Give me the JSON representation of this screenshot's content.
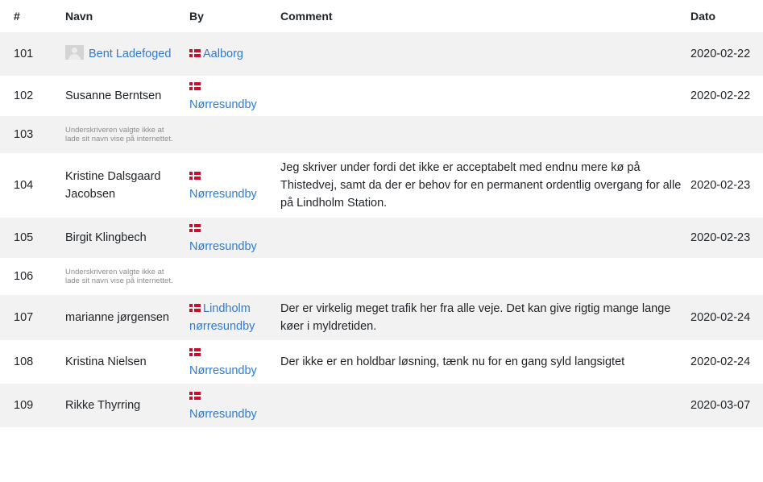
{
  "headers": {
    "num": "#",
    "name": "Navn",
    "city": "By",
    "comment": "Comment",
    "date": "Dato"
  },
  "hidden_note": "Underskriveren valgte ikke at lade sit navn vise på internettet.",
  "colors": {
    "link": "#2e7bd6",
    "stripe": "#f2f2f2",
    "flag_red": "#c8102e"
  },
  "rows": [
    {
      "num": "101",
      "name": "Bent Ladefoged",
      "name_link": true,
      "avatar": true,
      "city": "Aalborg",
      "flag": true,
      "comment": "",
      "date": "2020-02-22"
    },
    {
      "num": "102",
      "name": "Susanne Berntsen",
      "name_link": false,
      "avatar": false,
      "city": "Nørresundby",
      "flag": true,
      "comment": "",
      "date": "2020-02-22"
    },
    {
      "num": "103",
      "hidden": true,
      "city": "",
      "comment": "",
      "date": ""
    },
    {
      "num": "104",
      "name": "Kristine Dalsgaard Jacobsen",
      "name_link": false,
      "avatar": false,
      "city": "Nørresundby",
      "flag": true,
      "comment": "Jeg skriver under fordi det ikke er acceptabelt med endnu mere kø på Thistedvej, samt da der er behov for en permanent ordentlig overgang for alle på Lindholm Station.",
      "date": "2020-02-23"
    },
    {
      "num": "105",
      "name": "Birgit Klingbech",
      "name_link": false,
      "avatar": false,
      "city": "Nørresundby",
      "flag": true,
      "comment": "",
      "date": "2020-02-23"
    },
    {
      "num": "106",
      "hidden": true,
      "city": "",
      "comment": "",
      "date": ""
    },
    {
      "num": "107",
      "name": "marianne jørgensen",
      "name_link": false,
      "avatar": false,
      "city": "Lindholm nørresundby",
      "flag": true,
      "comment": "Der er virkelig meget trafik her fra alle veje. Det kan give rigtig mange lange køer i myldretiden.",
      "date": "2020-02-24"
    },
    {
      "num": "108",
      "name": "Kristina Nielsen",
      "name_link": false,
      "avatar": false,
      "city": "Nørresundby",
      "flag": true,
      "comment": "Der ikke er en holdbar løsning, tænk nu for en gang syld langsigtet",
      "date": "2020-02-24"
    },
    {
      "num": "109",
      "name": "Rikke Thyrring",
      "name_link": false,
      "avatar": false,
      "city": "Nørresundby",
      "flag": true,
      "comment": "",
      "date": "2020-03-07"
    }
  ]
}
